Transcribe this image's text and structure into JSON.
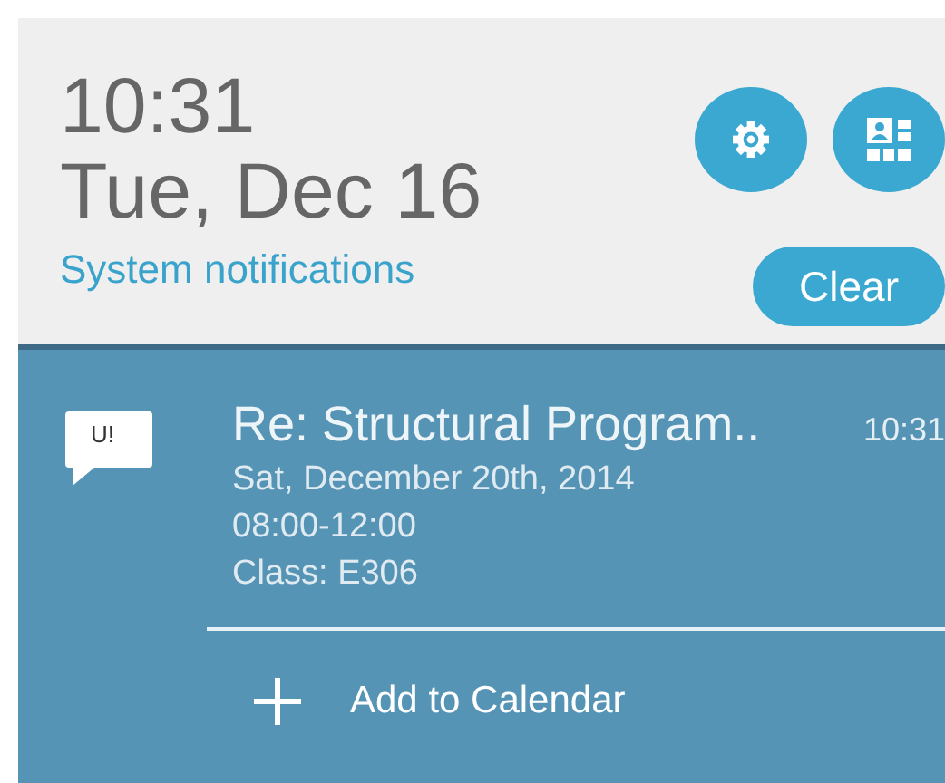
{
  "clock": {
    "time": "10:31",
    "date": "Tue, Dec 16"
  },
  "system_notifications_link": "System notifications",
  "quick_buttons": [
    {
      "kind": "settings"
    },
    {
      "kind": "contacts"
    }
  ],
  "clear_button": "Clear",
  "notification": {
    "badge": "U!",
    "title": "Re: Structural Program..",
    "time": "10:31",
    "lines": [
      "Sat, December 20th, 2014",
      "08:00-12:00",
      "Class: E306"
    ],
    "action": "Add to Calendar"
  }
}
